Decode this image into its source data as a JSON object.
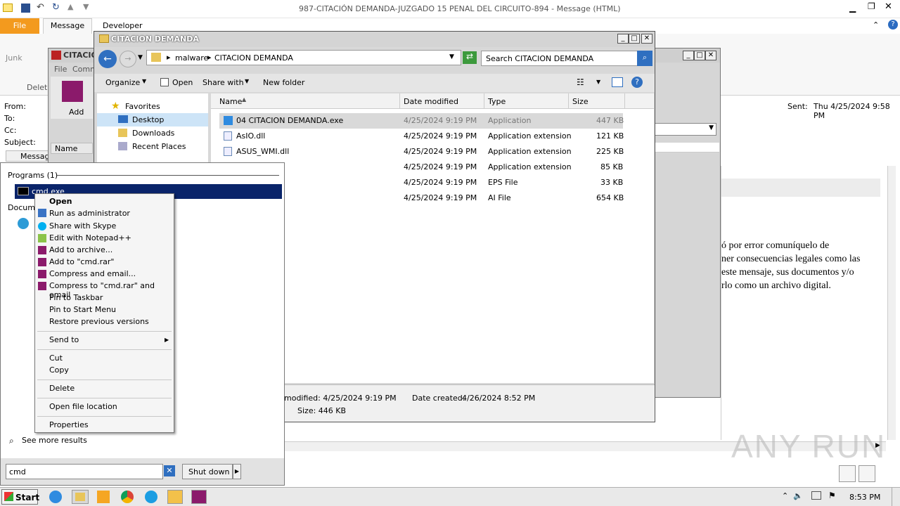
{
  "outlook": {
    "title": "987-CITACIÓN  DEMANDA-JUZGADO 15 PENAL DEL CIRCUITO-894 -  Message (HTML)",
    "tabs": [
      "File",
      "Message",
      "Developer"
    ],
    "junk": "Junk",
    "delete": "Delet",
    "from": "From:",
    "to": "To:",
    "cc": "Cc:",
    "subject": "Subject:",
    "sent_label": "Sent:",
    "sent_value": "Thu 4/25/2024 9:58 PM",
    "message_tab": "Message",
    "body_lines": [
      "ó por error comuníquelo de",
      "ner consecuencias legales como las",
      "este mensaje, sus documentos y/o",
      "rlo como un archivo digital."
    ]
  },
  "explorer_back": {
    "title": "CITACION",
    "menu": [
      "File",
      "Comm"
    ],
    "add": "Add",
    "name_col": "Name"
  },
  "explorer": {
    "title": "CITACION DEMANDA",
    "breadcrumb": [
      "malware",
      "CITACION DEMANDA"
    ],
    "search_placeholder": "Search CITACION DEMANDA",
    "toolbar": [
      "Organize",
      "Open",
      "Share with",
      "New folder"
    ],
    "nav": {
      "favorites": "Favorites",
      "items": [
        "Desktop",
        "Downloads",
        "Recent Places"
      ]
    },
    "columns": [
      "Name",
      "Date modified",
      "Type",
      "Size"
    ],
    "files": [
      {
        "name": "04 CITACION DEMANDA.exe",
        "date": "4/25/2024 9:19 PM",
        "type": "Application",
        "size": "447 KB"
      },
      {
        "name": "AsIO.dll",
        "date": "4/25/2024 9:19 PM",
        "type": "Application extension",
        "size": "121 KB"
      },
      {
        "name": "ASUS_WMI.dll",
        "date": "4/25/2024 9:19 PM",
        "type": "Application extension",
        "size": "225 KB"
      },
      {
        "name": "",
        "date": "4/25/2024 9:19 PM",
        "type": "Application extension",
        "size": "85 KB"
      },
      {
        "name": "",
        "date": "4/25/2024 9:19 PM",
        "type": "EPS File",
        "size": "33 KB"
      },
      {
        "name": "",
        "date": "4/25/2024 9:19 PM",
        "type": "AI File",
        "size": "654 KB"
      }
    ],
    "details": {
      "modified": "modified:  4/25/2024 9:19 PM",
      "created_label": "Date created:",
      "created": "4/26/2024 8:52 PM",
      "size": "Size:  446 KB"
    }
  },
  "startmenu": {
    "programs_header": "Programs (1)",
    "program": "cmd.exe",
    "documents_header": "Docume",
    "see_more": "See more results",
    "search_value": "cmd",
    "shutdown": "Shut down"
  },
  "context_menu": {
    "items": [
      "Open",
      "Run as administrator",
      "Share with Skype",
      "Edit with Notepad++",
      "Add to archive...",
      "Add to \"cmd.rar\"",
      "Compress and email...",
      "Compress to \"cmd.rar\" and email",
      "Pin to Taskbar",
      "Pin to Start Menu",
      "Restore previous versions",
      "Send to",
      "Cut",
      "Copy",
      "Delete",
      "Open file location",
      "Properties"
    ]
  },
  "taskbar": {
    "start": "Start",
    "clock": "8:53 PM"
  },
  "watermark": "ANY RUN"
}
